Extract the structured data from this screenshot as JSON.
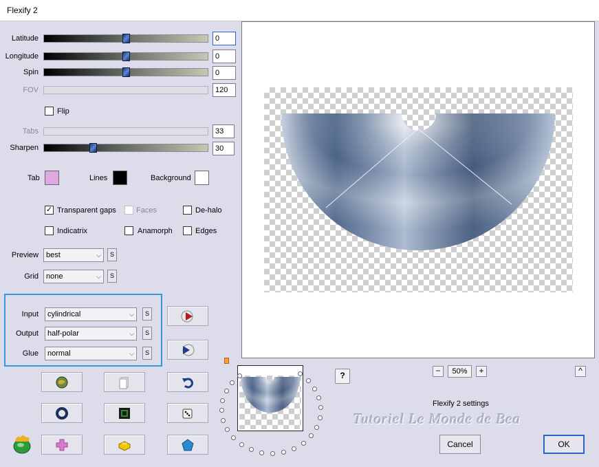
{
  "window": {
    "title": "Flexify 2"
  },
  "sliders": {
    "latitude": {
      "label": "Latitude",
      "value": "0",
      "fraction": 0.5
    },
    "longitude": {
      "label": "Longitude",
      "value": "0",
      "fraction": 0.5
    },
    "spin": {
      "label": "Spin",
      "value": "0",
      "fraction": 0.5
    },
    "fov": {
      "label": "FOV",
      "value": "120"
    },
    "tabs": {
      "label": "Tabs",
      "value": "33"
    },
    "sharpen": {
      "label": "Sharpen",
      "value": "30",
      "fraction": 0.3
    }
  },
  "flip": {
    "label": "Flip",
    "checked": false
  },
  "colors": {
    "tab": {
      "label": "Tab",
      "color": "#e0a8e0"
    },
    "lines": {
      "label": "Lines",
      "color": "#000000"
    },
    "background": {
      "label": "Background",
      "color": "#ffffff"
    }
  },
  "options": {
    "transparent_gaps": {
      "label": "Transparent gaps",
      "checked": true
    },
    "faces": {
      "label": "Faces",
      "checked": false,
      "disabled": true
    },
    "de_halo": {
      "label": "De-halo",
      "checked": false
    },
    "indicatrix": {
      "label": "Indicatrix",
      "checked": false
    },
    "anamorph": {
      "label": "Anamorph",
      "checked": false
    },
    "edges": {
      "label": "Edges",
      "checked": false
    }
  },
  "preview_select": {
    "label": "Preview",
    "value": "best"
  },
  "grid_select": {
    "label": "Grid",
    "value": "none"
  },
  "projection": {
    "input": {
      "label": "Input",
      "value": "cylindrical"
    },
    "output": {
      "label": "Output",
      "value": "half-polar"
    },
    "glue": {
      "label": "Glue",
      "value": "normal"
    }
  },
  "s_label": "S",
  "help_label": "?",
  "zoom": {
    "value": "50%",
    "minus": "−",
    "plus": "+",
    "collapse": "^"
  },
  "preset_name": "Flexify 2 settings",
  "watermark": "Tutoriel Le Monde de Bea",
  "buttons": {
    "cancel": "Cancel",
    "ok": "OK"
  },
  "icons": [
    "play-forward-icon",
    "play-back-icon",
    "random-planet-icon",
    "copy-icon",
    "undo-icon",
    "ring-icon",
    "square-frame-icon",
    "dice-icon",
    "cross-shape-icon",
    "lego-brick-icon",
    "pentagon-icon",
    "flexify-logo-icon"
  ]
}
